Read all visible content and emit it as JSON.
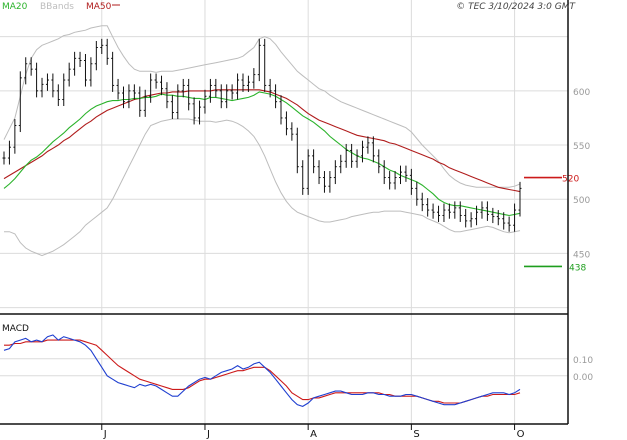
{
  "legend": {
    "ma20": {
      "label": "MA20",
      "color": "#2bb32b"
    },
    "bbands": {
      "label": "BBands",
      "color": "#bdbdbd"
    },
    "ma50": {
      "label": "MA50",
      "color": "#b01c1c"
    }
  },
  "copyright": "© TEC 3/10/2024 3:0 GMT",
  "panel_labels": {
    "macd": "MACD"
  },
  "colors": {
    "price": "#111111",
    "grid": "#dcdcdc",
    "axis_text": "#9a9a9a",
    "macd": "#1f3fd0",
    "signal": "#cc1a1a"
  },
  "chart_data": [
    {
      "type": "line",
      "name": "price",
      "ylim": [
        395,
        670
      ],
      "y_ticks": [
        450,
        500,
        550,
        600
      ],
      "x_ticks": [
        "J",
        "J",
        "A",
        "S",
        "O"
      ],
      "x_tick_index": [
        18,
        37,
        56,
        75,
        94
      ],
      "n_bars": 96,
      "ohlc_close": [
        538,
        548,
        568,
        612,
        625,
        620,
        600,
        606,
        610,
        600,
        592,
        610,
        620,
        630,
        628,
        610,
        625,
        640,
        642,
        630,
        605,
        598,
        590,
        600,
        598,
        582,
        595,
        610,
        608,
        602,
        590,
        580,
        600,
        605,
        588,
        575,
        585,
        595,
        605,
        600,
        590,
        600,
        598,
        610,
        605,
        608,
        615,
        642,
        605,
        600,
        590,
        575,
        565,
        560,
        530,
        510,
        540,
        530,
        520,
        512,
        520,
        530,
        535,
        545,
        535,
        540,
        548,
        552,
        540,
        530,
        520,
        515,
        520,
        525,
        522,
        510,
        500,
        495,
        490,
        488,
        485,
        490,
        488,
        492,
        485,
        480,
        482,
        488,
        492,
        486,
        484,
        482,
        478,
        476,
        490,
        510
      ],
      "ma20": [
        510,
        514,
        519,
        525,
        531,
        536,
        539,
        543,
        548,
        553,
        557,
        561,
        566,
        570,
        574,
        579,
        583,
        586,
        588,
        590,
        591,
        591,
        592,
        592,
        593,
        593,
        594,
        594,
        595,
        597,
        596,
        596,
        595,
        595,
        594,
        593,
        593,
        592,
        594,
        594,
        593,
        592,
        591,
        592,
        593,
        594,
        596,
        599,
        598,
        597,
        595,
        592,
        589,
        585,
        581,
        577,
        574,
        571,
        567,
        563,
        558,
        554,
        550,
        546,
        543,
        540,
        538,
        537,
        535,
        533,
        530,
        527,
        525,
        522,
        520,
        518,
        516,
        513,
        509,
        505,
        500,
        497,
        495,
        494,
        494,
        493,
        492,
        491,
        490,
        489,
        488,
        487,
        486,
        485,
        486,
        487
      ],
      "ma50": [
        519,
        522,
        525,
        528,
        531,
        534,
        537,
        540,
        544,
        547,
        550,
        554,
        557,
        561,
        565,
        569,
        572,
        576,
        579,
        582,
        584,
        586,
        588,
        590,
        592,
        593,
        595,
        596,
        597,
        598,
        598,
        599,
        599,
        599,
        600,
        600,
        600,
        600,
        600,
        601,
        601,
        601,
        601,
        601,
        601,
        601,
        601,
        601,
        600,
        599,
        597,
        595,
        593,
        590,
        587,
        583,
        579,
        576,
        573,
        571,
        569,
        567,
        565,
        563,
        561,
        559,
        558,
        557,
        556,
        555,
        554,
        552,
        551,
        549,
        547,
        545,
        543,
        541,
        539,
        537,
        534,
        532,
        529,
        527,
        525,
        523,
        521,
        519,
        517,
        515,
        513,
        511,
        510,
        509,
        508,
        507
      ],
      "bb_upper": [
        555,
        565,
        575,
        595,
        615,
        630,
        638,
        642,
        644,
        646,
        648,
        651,
        652,
        654,
        655,
        656,
        658,
        659,
        660,
        660,
        650,
        640,
        632,
        625,
        620,
        618,
        618,
        618,
        617,
        618,
        618,
        618,
        619,
        620,
        621,
        622,
        623,
        624,
        625,
        626,
        627,
        628,
        629,
        630,
        632,
        636,
        640,
        648,
        650,
        648,
        643,
        636,
        630,
        624,
        618,
        614,
        610,
        606,
        602,
        600,
        596,
        593,
        590,
        588,
        586,
        584,
        582,
        580,
        578,
        576,
        574,
        572,
        570,
        568,
        566,
        562,
        556,
        550,
        545,
        540,
        535,
        528,
        522,
        518,
        515,
        513,
        512,
        511,
        511,
        511,
        511,
        511,
        511,
        511,
        512,
        514
      ],
      "bb_lower": [
        470,
        470,
        468,
        460,
        455,
        452,
        450,
        448,
        450,
        452,
        455,
        458,
        462,
        466,
        470,
        476,
        480,
        484,
        488,
        492,
        500,
        510,
        520,
        530,
        540,
        550,
        560,
        568,
        570,
        572,
        573,
        574,
        574,
        574,
        574,
        573,
        572,
        572,
        572,
        571,
        572,
        573,
        572,
        570,
        567,
        563,
        558,
        550,
        540,
        528,
        516,
        506,
        498,
        492,
        488,
        486,
        484,
        482,
        480,
        479,
        479,
        480,
        481,
        482,
        484,
        485,
        486,
        487,
        488,
        488,
        489,
        489,
        489,
        489,
        488,
        487,
        486,
        485,
        482,
        480,
        478,
        475,
        472,
        470,
        470,
        471,
        472,
        473,
        474,
        475,
        474,
        472,
        470,
        469,
        470,
        471
      ],
      "reference_lines": [
        {
          "label": "520",
          "value": 520,
          "color": "#cc1a1a"
        },
        {
          "label": "438",
          "value": 438,
          "color": "#1e9e1e"
        }
      ]
    },
    {
      "type": "line",
      "name": "MACD",
      "ylim": [
        -0.26,
        0.34
      ],
      "y_ticks": [
        0.1,
        0.0
      ],
      "y_tick_labels": [
        "0.10",
        "0.00"
      ],
      "macd": [
        0.15,
        0.16,
        0.2,
        0.21,
        0.22,
        0.2,
        0.21,
        0.2,
        0.23,
        0.24,
        0.21,
        0.23,
        0.22,
        0.21,
        0.2,
        0.18,
        0.15,
        0.1,
        0.05,
        0.0,
        -0.02,
        -0.04,
        -0.05,
        -0.06,
        -0.07,
        -0.05,
        -0.06,
        -0.05,
        -0.06,
        -0.08,
        -0.1,
        -0.12,
        -0.12,
        -0.09,
        -0.06,
        -0.04,
        -0.02,
        -0.01,
        -0.02,
        0.0,
        0.02,
        0.03,
        0.04,
        0.06,
        0.04,
        0.05,
        0.07,
        0.08,
        0.05,
        0.02,
        -0.02,
        -0.06,
        -0.1,
        -0.14,
        -0.17,
        -0.18,
        -0.16,
        -0.13,
        -0.12,
        -0.11,
        -0.1,
        -0.09,
        -0.09,
        -0.1,
        -0.11,
        -0.11,
        -0.11,
        -0.1,
        -0.1,
        -0.11,
        -0.11,
        -0.12,
        -0.12,
        -0.12,
        -0.11,
        -0.11,
        -0.12,
        -0.13,
        -0.14,
        -0.15,
        -0.16,
        -0.17,
        -0.17,
        -0.17,
        -0.16,
        -0.15,
        -0.14,
        -0.13,
        -0.12,
        -0.11,
        -0.1,
        -0.1,
        -0.1,
        -0.11,
        -0.1,
        -0.08
      ],
      "signal": [
        0.18,
        0.18,
        0.19,
        0.19,
        0.2,
        0.2,
        0.2,
        0.2,
        0.21,
        0.21,
        0.21,
        0.21,
        0.21,
        0.21,
        0.21,
        0.2,
        0.19,
        0.18,
        0.15,
        0.12,
        0.09,
        0.06,
        0.04,
        0.02,
        0.0,
        -0.02,
        -0.03,
        -0.04,
        -0.05,
        -0.06,
        -0.07,
        -0.08,
        -0.08,
        -0.08,
        -0.07,
        -0.05,
        -0.03,
        -0.02,
        -0.02,
        -0.01,
        0.0,
        0.01,
        0.02,
        0.03,
        0.03,
        0.04,
        0.05,
        0.05,
        0.05,
        0.03,
        0.0,
        -0.03,
        -0.06,
        -0.1,
        -0.12,
        -0.14,
        -0.14,
        -0.13,
        -0.13,
        -0.12,
        -0.11,
        -0.1,
        -0.1,
        -0.1,
        -0.1,
        -0.1,
        -0.1,
        -0.1,
        -0.1,
        -0.1,
        -0.11,
        -0.11,
        -0.12,
        -0.12,
        -0.12,
        -0.12,
        -0.12,
        -0.13,
        -0.14,
        -0.15,
        -0.15,
        -0.16,
        -0.16,
        -0.16,
        -0.16,
        -0.15,
        -0.14,
        -0.13,
        -0.12,
        -0.12,
        -0.11,
        -0.11,
        -0.11,
        -0.11,
        -0.11,
        -0.1
      ]
    }
  ]
}
